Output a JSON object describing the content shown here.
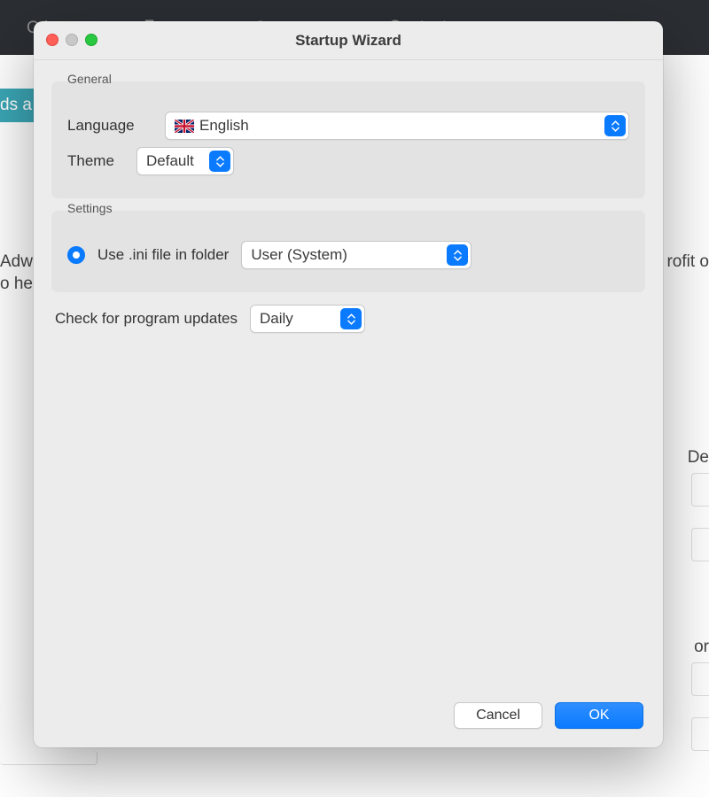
{
  "bg": {
    "nav": [
      "Other ▾",
      "Forum",
      "Support ▾",
      "Contact"
    ],
    "teal_fragment": "ds a",
    "line1_left": "Adw",
    "line2_left": "o he",
    "right1": "rofit o",
    "right_label_de": "De",
    "right_label_or": "or"
  },
  "dialog": {
    "title": "Startup Wizard",
    "groups": {
      "general": {
        "title": "General",
        "language_label": "Language",
        "language_value": "English",
        "language_flag": "uk",
        "theme_label": "Theme",
        "theme_value": "Default"
      },
      "settings": {
        "title": "Settings",
        "ini_radio_label": "Use .ini file in folder",
        "ini_location_value": "User (System)"
      }
    },
    "updates_label": "Check for program updates",
    "updates_value": "Daily",
    "buttons": {
      "cancel": "Cancel",
      "ok": "OK"
    }
  }
}
